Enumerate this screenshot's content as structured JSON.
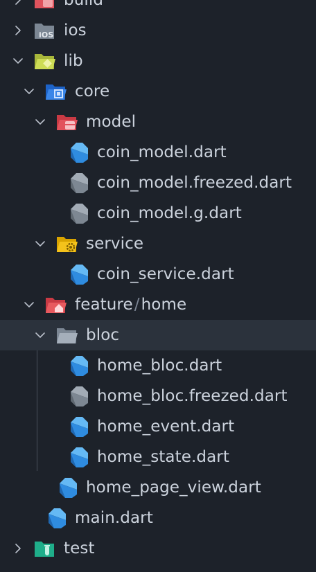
{
  "tree": {
    "build": "build",
    "ios": "ios",
    "lib": "lib",
    "core": "core",
    "model": "model",
    "coin_model": "coin_model.dart",
    "coin_model_freezed": "coin_model.freezed.dart",
    "coin_model_g": "coin_model.g.dart",
    "service": "service",
    "coin_service": "coin_service.dart",
    "feature": "feature",
    "feature_sep": "/",
    "home": "home",
    "bloc": "bloc",
    "home_bloc": "home_bloc.dart",
    "home_bloc_freezed": "home_bloc.freezed.dart",
    "home_event": "home_event.dart",
    "home_state": "home_state.dart",
    "home_page_view": "home_page_view.dart",
    "main": "main.dart",
    "test": "test"
  },
  "icons": {
    "chevron_right": "chevron-right-icon",
    "chevron_down": "chevron-down-icon",
    "dart": "dart-file-icon",
    "dart_generated": "dart-generated-file-icon"
  },
  "colors": {
    "background": "#1d222a",
    "selected_row": "#2b323c",
    "text": "#ccd3dd",
    "dart_blue": "#2f8ce0",
    "generated_grey": "#7d8792"
  }
}
